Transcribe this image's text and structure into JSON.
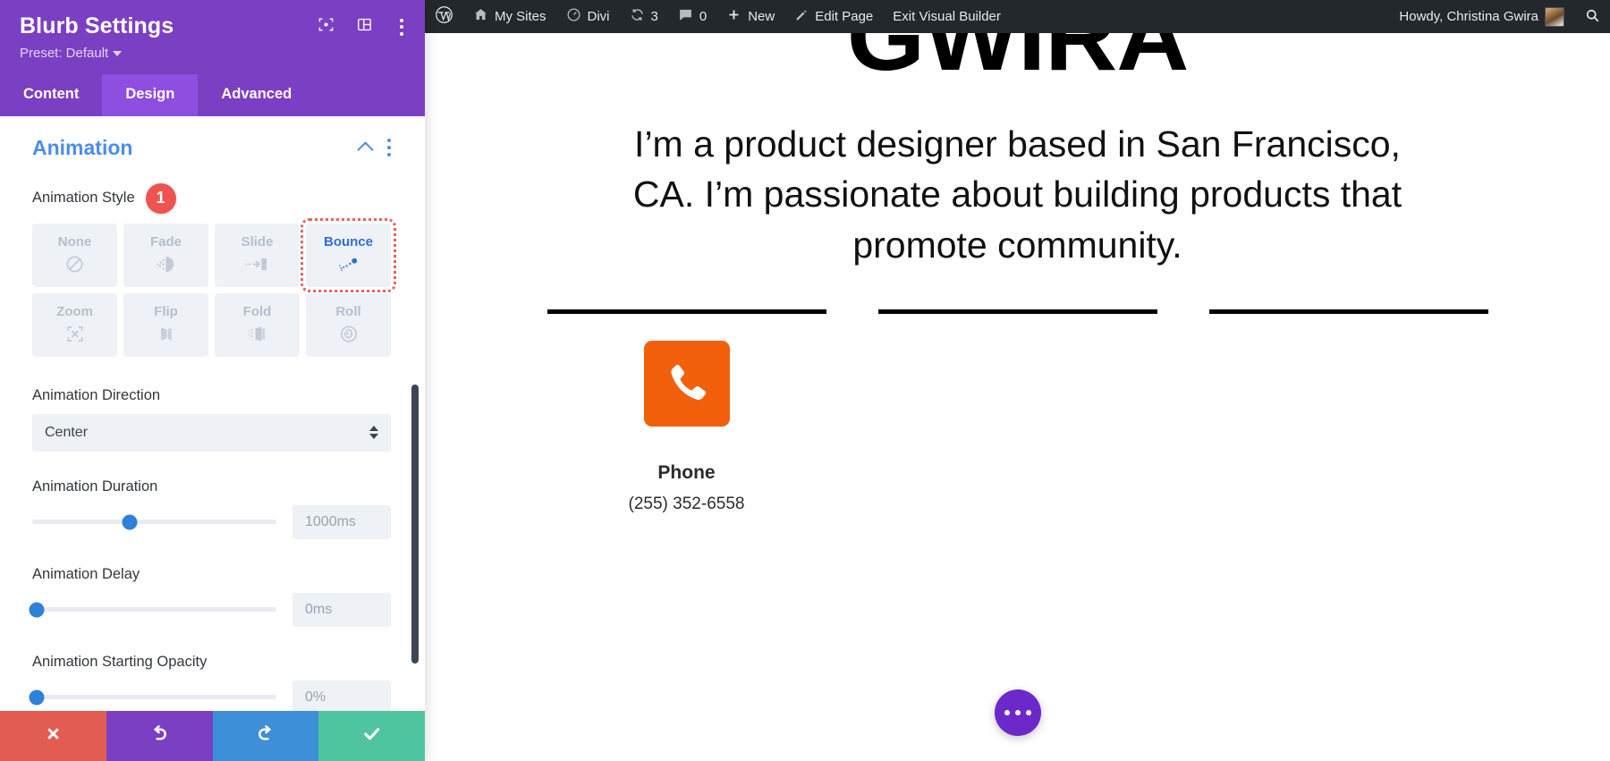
{
  "panel": {
    "title": "Blurb Settings",
    "preset_label": "Preset: Default",
    "header_icons": [
      {
        "name": "focus-target-icon"
      },
      {
        "name": "layout-columns-icon"
      },
      {
        "name": "kebab-menu-icon"
      }
    ],
    "tabs": [
      {
        "label": "Content",
        "active": false
      },
      {
        "label": "Design",
        "active": true
      },
      {
        "label": "Advanced",
        "active": false
      }
    ],
    "section": {
      "title": "Animation",
      "collapse_icon": "chevron-up-icon",
      "more_icon": "kebab-menu-icon"
    },
    "animation_style": {
      "label": "Animation Style",
      "badge": "1",
      "badge_color": "#ef5350",
      "selected": "Bounce",
      "options": [
        {
          "label": "None",
          "icon": "no-entry-icon"
        },
        {
          "label": "Fade",
          "icon": "fade-icon"
        },
        {
          "label": "Slide",
          "icon": "slide-icon"
        },
        {
          "label": "Bounce",
          "icon": "bounce-icon"
        },
        {
          "label": "Zoom",
          "icon": "zoom-expand-icon"
        },
        {
          "label": "Flip",
          "icon": "flip-icon"
        },
        {
          "label": "Fold",
          "icon": "fold-icon"
        },
        {
          "label": "Roll",
          "icon": "roll-spiral-icon"
        }
      ]
    },
    "animation_direction": {
      "label": "Animation Direction",
      "value": "Center"
    },
    "animation_duration": {
      "label": "Animation Duration",
      "value": "1000ms",
      "knob_percent": 40
    },
    "animation_delay": {
      "label": "Animation Delay",
      "value": "0ms",
      "knob_percent": 2
    },
    "animation_starting_opacity": {
      "label": "Animation Starting Opacity",
      "value": "0%",
      "knob_percent": 2
    },
    "actions": [
      {
        "name": "cancel-button",
        "icon": "close-x-icon",
        "color": "#e25c52"
      },
      {
        "name": "undo-button",
        "icon": "undo-arrow-icon",
        "color": "#7b3fc4"
      },
      {
        "name": "redo-button",
        "icon": "redo-arrow-icon",
        "color": "#3d8fd8"
      },
      {
        "name": "save-button",
        "icon": "checkmark-icon",
        "color": "#4fc4a0"
      }
    ]
  },
  "adminbar": {
    "items": [
      {
        "label": "",
        "icon": "wordpress-logo-icon"
      },
      {
        "label": "My Sites",
        "icon": "multisite-icon"
      },
      {
        "label": "Divi",
        "icon": "divi-speedometer-icon"
      },
      {
        "label": "3",
        "icon": "updates-refresh-icon"
      },
      {
        "label": "0",
        "icon": "comment-bubble-icon"
      },
      {
        "label": "New",
        "icon": "plus-icon"
      },
      {
        "label": "Edit Page",
        "icon": "pencil-icon"
      },
      {
        "label": "Exit Visual Builder",
        "icon": ""
      }
    ],
    "howdy": "Howdy, Christina Gwira",
    "search_icon": "search-icon"
  },
  "canvas": {
    "logo_word": "GWIRA",
    "lede": "I’m a product designer based in San Francisco, CA. I’m passionate about building products that promote community.",
    "cards": [
      {
        "title": "Phone",
        "text": "(255) 352-6558",
        "icon": "phone-handset-icon",
        "icon_color": "#f2600c"
      }
    ],
    "fab": {
      "name": "page-settings-fab",
      "icon": "ellipsis-icon",
      "color": "#6d28c9"
    }
  }
}
